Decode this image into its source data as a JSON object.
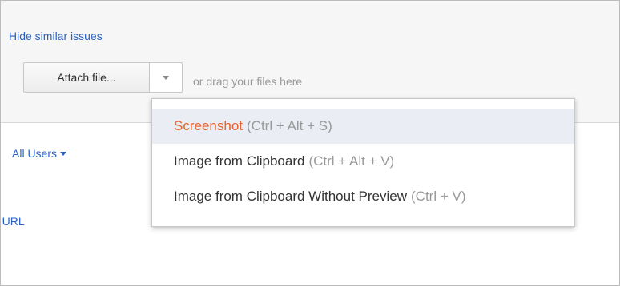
{
  "attachments": {
    "hide_similar_label": "Hide similar issues",
    "attach_button_label": "Attach file...",
    "drag_hint": "or drag your files here"
  },
  "filters": {
    "all_users_label": "All Users"
  },
  "partial": {
    "url_label": "e URL"
  },
  "attach_menu": {
    "items": [
      {
        "label": "Screenshot",
        "shortcut": "(Ctrl + Alt + S)",
        "highlighted": true
      },
      {
        "label": "Image from Clipboard",
        "shortcut": "(Ctrl + Alt + V)",
        "highlighted": false
      },
      {
        "label": "Image from Clipboard Without Preview",
        "shortcut": "(Ctrl + V)",
        "highlighted": false
      }
    ]
  },
  "colors": {
    "link": "#2a62c4",
    "highlight_text": "#e8632f",
    "highlight_bg": "#eaeef4",
    "shortcut_text": "#9a9a9a"
  }
}
